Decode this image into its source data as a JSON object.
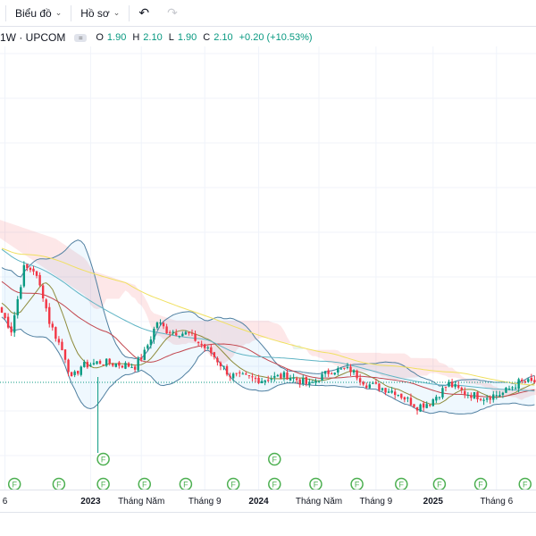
{
  "toolbar": {
    "chart_menu": "Biểu đồ",
    "profile_menu": "Hồ sơ",
    "undo_icon": "undo-icon",
    "redo_icon": "redo-icon"
  },
  "legend": {
    "symbol": "1W · UPCOM",
    "open_label": "O",
    "open": "1.90",
    "high_label": "H",
    "high": "2.10",
    "low_label": "L",
    "low": "1.90",
    "close_label": "C",
    "close": "2.10",
    "change": "+0.20 (+10.53%)"
  },
  "x_axis": [
    {
      "label": "6",
      "week": 1
    },
    {
      "label": "2023",
      "week": 28
    },
    {
      "label": "Tháng Năm",
      "week": 44
    },
    {
      "label": "Tháng 9",
      "week": 64
    },
    {
      "label": "2024",
      "week": 81
    },
    {
      "label": "Tháng Năm",
      "week": 100
    },
    {
      "label": "Tháng 9",
      "week": 118
    },
    {
      "label": "2025",
      "week": 136
    },
    {
      "label": "Tháng 6",
      "week": 156
    }
  ],
  "colors": {
    "up": "#089981",
    "down": "#f23645",
    "bb": "#4f7fa0",
    "ma_fast": "#8d8a3a",
    "ma_mid": "#c2474f",
    "ma_slow": "#f0e060",
    "ma_long": "#5fb4c4",
    "event": "#4caf50"
  },
  "chart_data": {
    "type": "candlestick",
    "interval": "1W",
    "last_close": 2.1,
    "close_path": [
      [
        0,
        3.4
      ],
      [
        3,
        3.07
      ],
      [
        7,
        4.23
      ],
      [
        10,
        4.2
      ],
      [
        13,
        3.73
      ],
      [
        15,
        3.23
      ],
      [
        20,
        2.57
      ],
      [
        22,
        2.15
      ],
      [
        25,
        2.4
      ],
      [
        31,
        2.48
      ],
      [
        42,
        2.4
      ],
      [
        45,
        2.65
      ],
      [
        49,
        3.23
      ],
      [
        52,
        3.07
      ],
      [
        59,
        3.0
      ],
      [
        66,
        2.65
      ],
      [
        72,
        2.23
      ],
      [
        82,
        2.15
      ],
      [
        90,
        2.23
      ],
      [
        97,
        2.05
      ],
      [
        104,
        2.33
      ],
      [
        110,
        2.33
      ],
      [
        115,
        2.07
      ],
      [
        124,
        1.93
      ],
      [
        131,
        1.65
      ],
      [
        135,
        1.73
      ],
      [
        141,
        2.07
      ],
      [
        146,
        1.9
      ],
      [
        152,
        1.82
      ],
      [
        158,
        1.9
      ],
      [
        163,
        2.1
      ],
      [
        168,
        2.1
      ]
    ],
    "events": [
      {
        "label": "F",
        "week": 4
      },
      {
        "label": "F",
        "week": 18
      },
      {
        "label": "F",
        "week": 32
      },
      {
        "label": "F",
        "week": 32
      },
      {
        "label": "F",
        "week": 45
      },
      {
        "label": "F",
        "week": 58
      },
      {
        "label": "F",
        "week": 73
      },
      {
        "label": "F",
        "week": 86
      },
      {
        "label": "F",
        "week": 86
      },
      {
        "label": "F",
        "week": 99
      },
      {
        "label": "F",
        "week": 112
      },
      {
        "label": "F",
        "week": 126
      },
      {
        "label": "F",
        "week": 138
      },
      {
        "label": "F",
        "week": 151
      },
      {
        "label": "F",
        "week": 165
      }
    ],
    "indicators": [
      "Bollinger Bands",
      "Ichimoku Cloud",
      "MA fast",
      "MA mid",
      "MA slow",
      "MA long"
    ]
  }
}
